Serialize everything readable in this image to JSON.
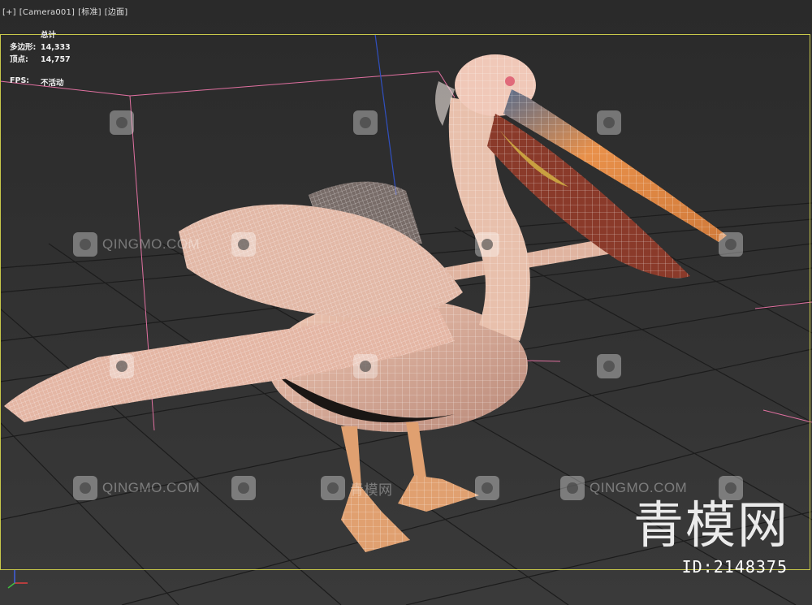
{
  "viewport": {
    "label_parts": [
      "[+]",
      "[Camera001]",
      "[标准]",
      "[边面]"
    ]
  },
  "stats": {
    "header": "总计",
    "polygons_label": "多边形:",
    "polygons_value": "14,333",
    "vertices_label": "顶点:",
    "vertices_value": "14,757",
    "fps_label": "FPS:",
    "fps_value": "不活动"
  },
  "watermarks": {
    "site": "QINGMO.COM",
    "cn": "青模网",
    "brand": "青模网",
    "id": "ID:2148375"
  },
  "colors": {
    "bg": "#333333",
    "grid": "#1e1e1e",
    "border": "#c8c84a",
    "bbox": "#e070a0",
    "skin": "#e8b8a0",
    "beak": "#e8904a"
  }
}
